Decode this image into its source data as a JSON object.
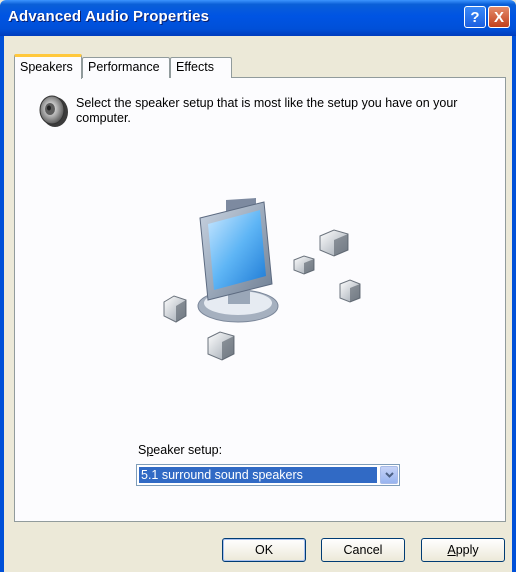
{
  "window": {
    "title": "Advanced Audio Properties"
  },
  "titlebar_buttons": {
    "help": "?",
    "close": "X"
  },
  "tabs": [
    {
      "label": "Speakers",
      "active": true
    },
    {
      "label": "Performance",
      "active": false
    },
    {
      "label": "Effects",
      "active": false
    }
  ],
  "speakers_tab": {
    "description": "Select the speaker setup that is most like the setup you have on your computer.",
    "setup_label_prefix": "S",
    "setup_label_access": "p",
    "setup_label_rest": "eaker setup:",
    "selected_setup": "5.1 surround sound speakers"
  },
  "buttons": {
    "ok": "OK",
    "cancel": "Cancel",
    "apply_access": "A",
    "apply_rest": "pply"
  },
  "colors": {
    "titlebar": "#0054e3",
    "selection": "#316ac5",
    "dialog_bg": "#ece9d8",
    "tab_highlight": "#ffc83c"
  },
  "icons": [
    "speaker-icon",
    "help-icon",
    "close-icon",
    "dropdown-arrow-icon"
  ]
}
